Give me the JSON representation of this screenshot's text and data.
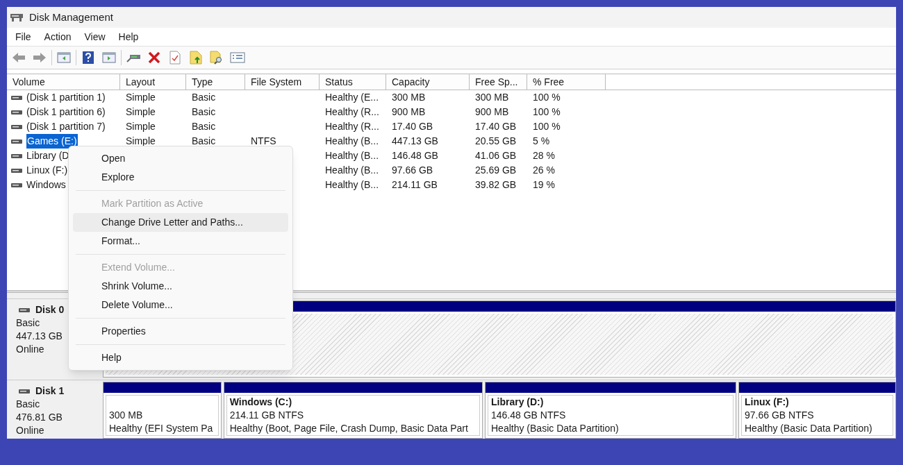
{
  "window": {
    "title": "Disk Management"
  },
  "menu": [
    "File",
    "Action",
    "View",
    "Help"
  ],
  "table": {
    "columns": [
      "Volume",
      "Layout",
      "Type",
      "File System",
      "Status",
      "Capacity",
      "Free Sp...",
      "% Free"
    ],
    "rows": [
      {
        "selected": false,
        "cells": [
          "(Disk 1 partition 1)",
          "Simple",
          "Basic",
          "",
          "Healthy (E...",
          "300 MB",
          "300 MB",
          "100 %"
        ]
      },
      {
        "selected": false,
        "cells": [
          "(Disk 1 partition 6)",
          "Simple",
          "Basic",
          "",
          "Healthy (R...",
          "900 MB",
          "900 MB",
          "100 %"
        ]
      },
      {
        "selected": false,
        "cells": [
          "(Disk 1 partition 7)",
          "Simple",
          "Basic",
          "",
          "Healthy (R...",
          "17.40 GB",
          "17.40 GB",
          "100 %"
        ]
      },
      {
        "selected": true,
        "cells": [
          "Games (E:)",
          "Simple",
          "Basic",
          "NTFS",
          "Healthy (B...",
          "447.13 GB",
          "20.55 GB",
          "5 %"
        ]
      },
      {
        "selected": false,
        "cells": [
          "Library (D",
          "",
          "",
          "",
          "Healthy (B...",
          "146.48 GB",
          "41.06 GB",
          "28 %"
        ]
      },
      {
        "selected": false,
        "cells": [
          "Linux (F:)",
          "",
          "",
          "",
          "Healthy (B...",
          "97.66 GB",
          "25.69 GB",
          "26 %"
        ]
      },
      {
        "selected": false,
        "cells": [
          "Windows",
          "",
          "",
          "",
          "Healthy (B...",
          "214.11 GB",
          "39.82 GB",
          "19 %"
        ]
      }
    ]
  },
  "context_menu": [
    {
      "kind": "item",
      "label": "Open",
      "disabled": false,
      "selected": false
    },
    {
      "kind": "item",
      "label": "Explore",
      "disabled": false,
      "selected": false
    },
    {
      "kind": "separator"
    },
    {
      "kind": "item",
      "label": "Mark Partition as Active",
      "disabled": true,
      "selected": false
    },
    {
      "kind": "item",
      "label": "Change Drive Letter and Paths...",
      "disabled": false,
      "selected": true
    },
    {
      "kind": "item",
      "label": "Format...",
      "disabled": false,
      "selected": false
    },
    {
      "kind": "separator"
    },
    {
      "kind": "item",
      "label": "Extend Volume...",
      "disabled": true,
      "selected": false
    },
    {
      "kind": "item",
      "label": "Shrink Volume...",
      "disabled": false,
      "selected": false
    },
    {
      "kind": "item",
      "label": "Delete Volume...",
      "disabled": false,
      "selected": false
    },
    {
      "kind": "separator"
    },
    {
      "kind": "item",
      "label": "Properties",
      "disabled": false,
      "selected": false
    },
    {
      "kind": "separator"
    },
    {
      "kind": "item",
      "label": "Help",
      "disabled": false,
      "selected": false
    }
  ],
  "disks": [
    {
      "name": "Disk 0",
      "type": "Basic",
      "size": "447.13 GB",
      "status": "Online",
      "partitions": [
        {
          "selected": true
        }
      ]
    },
    {
      "name": "Disk 1",
      "type": "Basic",
      "size": "476.81 GB",
      "status": "Online",
      "partitions": [
        {
          "selected": false,
          "size": "300 MB",
          "health": "Healthy (EFI System Pa"
        },
        {
          "selected": false,
          "title": "Windows  (C:)",
          "size": "214.11 GB NTFS",
          "health": "Healthy (Boot, Page File, Crash Dump, Basic Data Part"
        },
        {
          "selected": false,
          "title": "Library  (D:)",
          "size": "146.48 GB NTFS",
          "health": "Healthy (Basic Data Partition)"
        },
        {
          "selected": false,
          "title": "Linux  (F:)",
          "size": "97.66 GB NTFS",
          "health": "Healthy (Basic Data Partition)"
        }
      ]
    }
  ]
}
